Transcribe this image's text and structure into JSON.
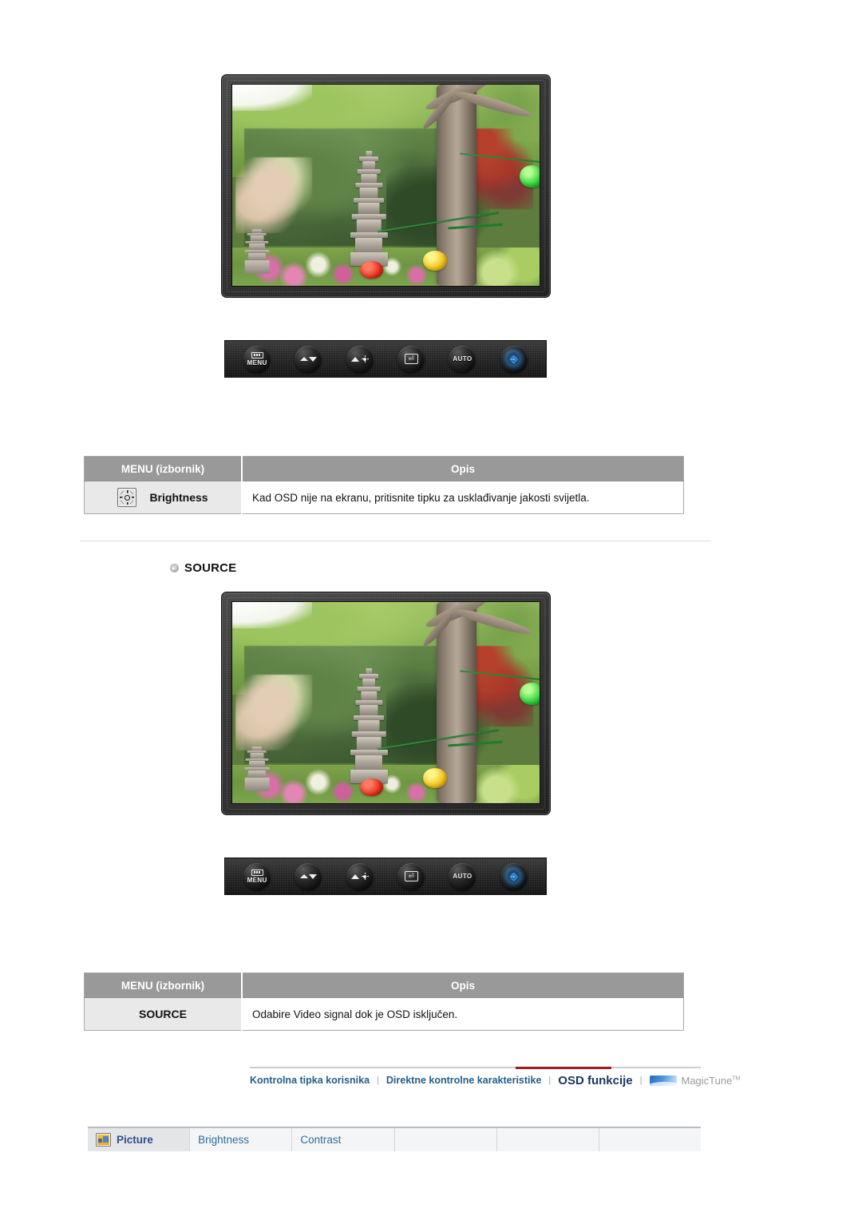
{
  "page": {
    "language": "hr",
    "accent_red": "#9e1b1b",
    "link_blue": "#265d88",
    "header_gray": "#999999",
    "menu_cell_gray": "#e9e9e9"
  },
  "sections": [
    {
      "id": "brightness",
      "heading": null,
      "monitor": {
        "alt": "LCD monitor displaying a garden photo with a stone pagoda and lanterns",
        "buttons": [
          {
            "name": "menu-button",
            "label": "MENU",
            "icon": "menu-icon"
          },
          {
            "name": "down-button",
            "label": "",
            "icon": "arrow-down-icon"
          },
          {
            "name": "brightness-up-button",
            "label": "",
            "icon": "brightness-up-icon"
          },
          {
            "name": "enter-button",
            "label": "",
            "icon": "enter-icon"
          },
          {
            "name": "auto-button",
            "label": "AUTO",
            "icon": "auto-icon"
          },
          {
            "name": "power-button",
            "label": "",
            "icon": "power-icon"
          }
        ]
      },
      "table": {
        "headers": [
          "MENU (izbornik)",
          "Opis"
        ],
        "row": {
          "icon": "brightness-icon",
          "menu": "Brightness",
          "description": "Kad OSD nije na ekranu, pritisnite tipku za usklađivanje jakosti svijetla."
        }
      }
    },
    {
      "id": "source",
      "heading": "SOURCE",
      "monitor": {
        "alt": "LCD monitor displaying a garden photo with a stone pagoda and lanterns",
        "buttons": [
          {
            "name": "menu-button",
            "label": "MENU",
            "icon": "menu-icon"
          },
          {
            "name": "down-button",
            "label": "",
            "icon": "arrow-down-icon"
          },
          {
            "name": "brightness-up-button",
            "label": "",
            "icon": "brightness-up-icon"
          },
          {
            "name": "enter-button",
            "label": "",
            "icon": "enter-icon"
          },
          {
            "name": "auto-button",
            "label": "AUTO",
            "icon": "auto-icon"
          },
          {
            "name": "power-button",
            "label": "",
            "icon": "power-icon"
          }
        ]
      },
      "table": {
        "headers": [
          "MENU (izbornik)",
          "Opis"
        ],
        "row": {
          "icon": null,
          "menu": "SOURCE",
          "description": "Odabire Video signal dok je OSD isključen."
        }
      }
    }
  ],
  "breadcrumb": {
    "separator": "|",
    "items": [
      {
        "label": "Kontrolna tipka korisnika",
        "active": false
      },
      {
        "label": "Direktne kontrolne karakteristike",
        "active": false
      },
      {
        "label": "OSD funkcije",
        "active": true
      }
    ],
    "logo": {
      "mark": "magictune-logo-icon",
      "text": "MagicTune",
      "trademark": "TM"
    }
  },
  "tabstrip": {
    "tabs": [
      {
        "label": "Picture",
        "icon": "picture-icon",
        "active": true
      },
      {
        "label": "Brightness",
        "icon": null,
        "active": false
      },
      {
        "label": "Contrast",
        "icon": null,
        "active": false
      },
      {
        "label": "",
        "icon": null,
        "active": false
      },
      {
        "label": "",
        "icon": null,
        "active": false
      },
      {
        "label": "",
        "icon": null,
        "active": false
      }
    ]
  }
}
